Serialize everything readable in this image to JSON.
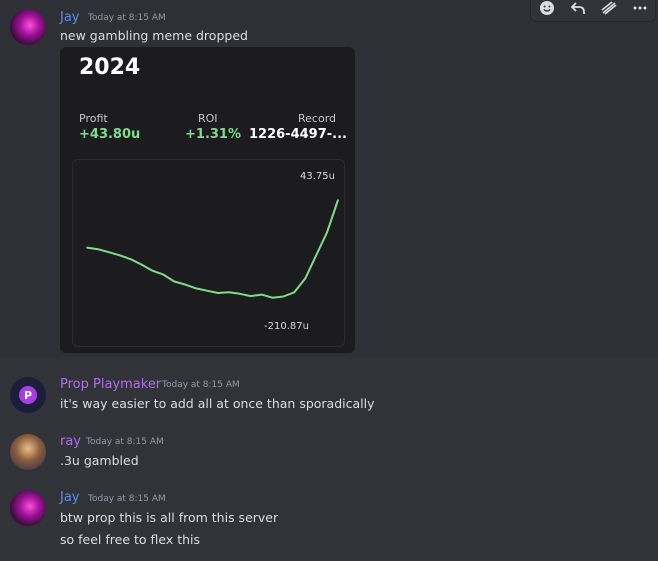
{
  "messages": [
    {
      "username": "Jay",
      "timestamp": "Today at 8:15 AM",
      "text": "new gambling meme dropped",
      "username_color": "#5b8cf3",
      "embed": {
        "year": "2024",
        "stats": {
          "profit_label": "Profit",
          "profit_value": "+43.80u",
          "roi_label": "ROI",
          "roi_value": "+1.31%",
          "record_label": "Record",
          "record_value": "1226-4497-..."
        },
        "chart": {
          "max_label": "43.75u",
          "min_label": "-210.87u"
        }
      }
    },
    {
      "username": "Prop Playmaker",
      "timestamp": "Today at 8:15 AM",
      "text": "it's way easier to add all at once than sporadically",
      "username_color": "#b36df0"
    },
    {
      "username": "ray",
      "timestamp": "Today at 8:15 AM",
      "text": ".3u gambled",
      "username_color": "#b36df0"
    },
    {
      "username": "Jay",
      "timestamp": "Today at 8:15 AM",
      "text": "btw prop this is all from this server",
      "text2": "so feel free to flex this",
      "username_color": "#5b8cf3"
    }
  ],
  "toolbar": {
    "icons": [
      "add-reaction-icon",
      "reply-icon",
      "forward-icon",
      "more-icon"
    ]
  },
  "chart_data": {
    "type": "line",
    "title": "2024",
    "xlabel": "",
    "ylabel": "",
    "ylim": [
      -210.87,
      43.75
    ],
    "series": [
      {
        "values": [
          -80,
          -84,
          -92,
          -100,
          -110,
          -124,
          -140,
          -150,
          -168,
          -176,
          -186,
          -192,
          -198,
          -196,
          -200,
          -206,
          -202,
          -210,
          -207,
          -196,
          -160,
          -100,
          -40,
          43.75
        ]
      }
    ],
    "annotations": [
      "43.75u",
      "-210.87u"
    ],
    "line_color": "#7fdc8b",
    "grid": false
  }
}
